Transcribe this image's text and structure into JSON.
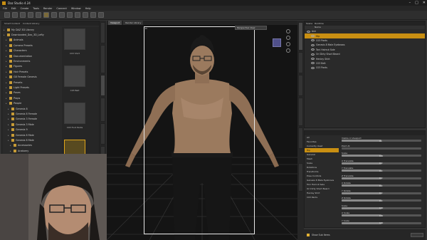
{
  "window": {
    "title": "Daz Studio 4.24",
    "controls": [
      "–",
      "□",
      "✕"
    ]
  },
  "menu": [
    "File",
    "Edit",
    "Create",
    "Tools",
    "Render",
    "Connect",
    "Window",
    "Help"
  ],
  "left_panel": {
    "tabs": [
      "Smart Content",
      "Content Library"
    ],
    "tree": [
      {
        "label": "My DAZ 3D Library",
        "depth": 0
      },
      {
        "label": "Downloaded_Daz_3D_Lefty",
        "depth": 0
      },
      {
        "label": "Animals",
        "depth": 1
      },
      {
        "label": "Camera Presets",
        "depth": 1
      },
      {
        "label": "Characters",
        "depth": 1
      },
      {
        "label": "Documentation",
        "depth": 1
      },
      {
        "label": "Environments",
        "depth": 1
      },
      {
        "label": "Figures",
        "depth": 1
      },
      {
        "label": "Hair Presets",
        "depth": 1
      },
      {
        "label": "G8 Female Genesis",
        "depth": 1
      },
      {
        "label": "Presets",
        "depth": 1
      },
      {
        "label": "Light Presets",
        "depth": 1
      },
      {
        "label": "Poses",
        "depth": 1
      },
      {
        "label": "Props",
        "depth": 1
      },
      {
        "label": "People",
        "depth": 1
      },
      {
        "label": "Genesis 8",
        "depth": 2
      },
      {
        "label": "Genesis 8 Female",
        "depth": 2
      },
      {
        "label": "Genesis 3 Female",
        "depth": 2
      },
      {
        "label": "Genesis 3 Male",
        "depth": 2
      },
      {
        "label": "Genesis 9",
        "depth": 2
      },
      {
        "label": "Genesis 8 Male",
        "depth": 2
      },
      {
        "label": "Genesis 8 Male",
        "depth": 2
      },
      {
        "label": "Accessories",
        "depth": 3
      },
      {
        "label": "Anatomy",
        "depth": 3
      },
      {
        "label": "Characters",
        "depth": 3
      },
      {
        "label": "Clothing",
        "depth": 3
      },
      {
        "label": "Clothing",
        "depth": 3
      },
      {
        "label": "Dolf Brown Jeans",
        "depth": 4
      },
      {
        "label": "Shoes",
        "depth": 4
      }
    ],
    "selected_index": 28,
    "thumbnails": [
      {
        "label": "C03 Shirt",
        "selected": false
      },
      {
        "label": "C03 Belt",
        "selected": false
      },
      {
        "label": "C03 Foot Pants",
        "selected": false
      },
      {
        "label": "C03 Pants",
        "selected": true
      }
    ]
  },
  "viewport": {
    "tabs": [
      "Viewport",
      "Render Library"
    ],
    "active_tab": 0,
    "frame_label": "Pi",
    "view_select": "Perspective View"
  },
  "scene": {
    "tabs": [
      "Scene",
      "Runtime"
    ],
    "header": "Name",
    "items": [
      {
        "label": "Ash",
        "selected": false
      },
      {
        "label": "Hip",
        "selected": true
      },
      {
        "label": "C03 Pants",
        "selected": false
      },
      {
        "label": "Genesis 8 Male Eyebrows",
        "selected": false
      },
      {
        "label": "Toni Haircut Sale",
        "selected": false
      },
      {
        "label": "Ori Dirty Short Beard",
        "selected": false
      },
      {
        "label": "Henley Shirt",
        "selected": false
      },
      {
        "label": "C03 Belt",
        "selected": false
      },
      {
        "label": "C03 Pants",
        "selected": false
      }
    ]
  },
  "parameters": {
    "categories": [
      {
        "label": "All",
        "selected": false
      },
      {
        "label": "Favorites",
        "selected": false
      },
      {
        "label": "Currently Used",
        "selected": false
      },
      {
        "label": "Hip",
        "selected": true
      },
      {
        "label": "General",
        "selected": false
      },
      {
        "label": "Mesh",
        "selected": false
      },
      {
        "label": "Scale",
        "selected": false
      },
      {
        "label": "Rotations",
        "selected": false
      },
      {
        "label": "Transforms",
        "selected": false
      },
      {
        "label": "Pose Controls",
        "selected": false
      },
      {
        "label": "Genesis 8 Male Eyebrows",
        "selected": false
      },
      {
        "label": "Toni Haircut Sale",
        "selected": false
      },
      {
        "label": "Ori Dirty Short Beard",
        "selected": false
      },
      {
        "label": "Henley Shirt",
        "selected": false
      },
      {
        "label": "C03 Pants",
        "selected": false
      }
    ],
    "sliders": [
      {
        "label": "Visible in Viewport",
        "value": "On",
        "fill": 0.5
      },
      {
        "label": "Point At",
        "value": "",
        "fill": 0.0
      },
      {
        "label": "Scale",
        "value": "100",
        "fill": 0.5
      },
      {
        "label": "X Translate",
        "value": "0.0",
        "fill": 0.5
      },
      {
        "label": "Y Translate",
        "value": "0.0",
        "fill": 0.5
      },
      {
        "label": "Z Translate",
        "value": "0.0",
        "fill": 0.5
      },
      {
        "label": "X Rotate",
        "value": "0.0",
        "fill": 0.5
      },
      {
        "label": "Y Rotate",
        "value": "0.0",
        "fill": 0.5
      },
      {
        "label": "Z Rotate",
        "value": "0.0",
        "fill": 0.5
      },
      {
        "label": "Scale",
        "value": "100",
        "fill": 0.5
      },
      {
        "label": "X Scale",
        "value": "100",
        "fill": 0.5
      },
      {
        "label": "Y Scale",
        "value": "100",
        "fill": 0.5
      }
    ],
    "footer_checkbox": "Show Sub Items"
  }
}
